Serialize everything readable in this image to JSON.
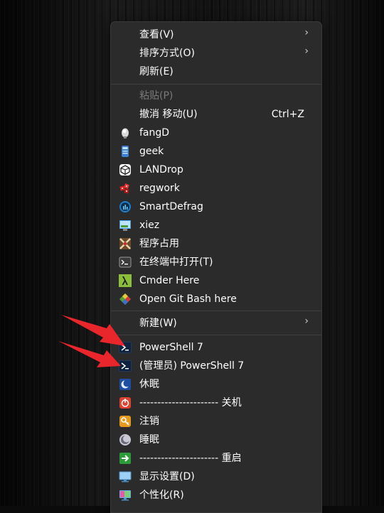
{
  "menu": {
    "view": {
      "label": "查看(V)"
    },
    "sort": {
      "label": "排序方式(O)"
    },
    "refresh": {
      "label": "刷新(E)"
    },
    "paste": {
      "label": "粘贴(P)"
    },
    "undo": {
      "label": "撤消 移动(U)",
      "shortcut": "Ctrl+Z"
    },
    "fangd": {
      "label": "fangD"
    },
    "geek": {
      "label": "geek"
    },
    "landrop": {
      "label": "LANDrop"
    },
    "regwork": {
      "label": "regwork"
    },
    "smartdefrag": {
      "label": "SmartDefrag"
    },
    "xiez": {
      "label": "xiez"
    },
    "program_usage": {
      "label": "程序占用"
    },
    "open_terminal": {
      "label": "在终端中打开(T)"
    },
    "cmder": {
      "label": "Cmder Here"
    },
    "git_bash": {
      "label": "Open Git Bash here"
    },
    "new": {
      "label": "新建(W)"
    },
    "powershell": {
      "label": "PowerShell 7"
    },
    "powershell_admin": {
      "label": "(管理员) PowerShell 7"
    },
    "hibernate": {
      "label": "休眠"
    },
    "shutdown": {
      "label": "---------------------- 关机"
    },
    "logoff": {
      "label": "注销"
    },
    "sleep": {
      "label": "睡眠"
    },
    "restart": {
      "label": "---------------------- 重启"
    },
    "display": {
      "label": "显示设置(D)"
    },
    "personalize": {
      "label": "个性化(R)"
    },
    "submenu_glyph": "›"
  },
  "colors": {
    "menu_bg": "#2b2b2b",
    "text": "#ffffff",
    "disabled_text": "#7a7a7a",
    "annotation_arrow": "#e8262b"
  },
  "icons": {
    "fangd": "fangd-icon",
    "geek": "geek-icon",
    "landrop": "landrop-icon",
    "regwork": "regwork-icon",
    "smartdefrag": "smartdefrag-icon",
    "xiez": "xiez-icon",
    "program_usage": "program-usage-icon",
    "open_terminal": "terminal-icon",
    "cmder": "cmder-lambda-icon",
    "git_bash": "git-icon",
    "powershell": "powershell-icon",
    "powershell_admin": "powershell-icon",
    "hibernate": "moon-icon",
    "shutdown": "power-icon",
    "logoff": "key-icon",
    "sleep": "sleep-icon",
    "restart": "restart-arrow-icon",
    "display": "monitor-icon",
    "personalize": "personalize-icon"
  }
}
